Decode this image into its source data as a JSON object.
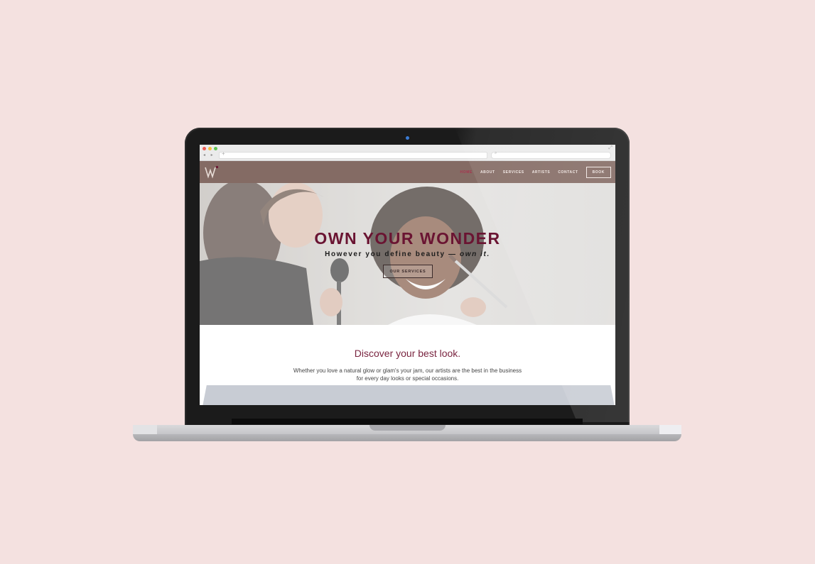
{
  "browser": {
    "url_icon": "+",
    "search_icon": "⌕",
    "nav_arrows": "◂ ▸"
  },
  "header": {
    "logo_alt": "W",
    "nav": [
      {
        "label": "HOME",
        "active": true
      },
      {
        "label": "ABOUT",
        "active": false
      },
      {
        "label": "SERVICES",
        "active": false
      },
      {
        "label": "ARTISTS",
        "active": false
      },
      {
        "label": "CONTACT",
        "active": false
      }
    ],
    "book_label": "BOOK"
  },
  "hero": {
    "title": "OWN YOUR WONDER",
    "subtitle_main": "However you define beauty — ",
    "subtitle_em": "own it.",
    "button_label": "OUR SERVICES"
  },
  "section": {
    "title": "Discover your best look.",
    "body_line1": "Whether you love a natural glow or glam's your jam, our artists are the best in the business",
    "body_line2": "for every day looks or special occasions."
  },
  "colors": {
    "page_background": "#f4e1e0",
    "header_background": "#846b64",
    "accent": "#6a1432",
    "nav_active": "#a8344f"
  }
}
